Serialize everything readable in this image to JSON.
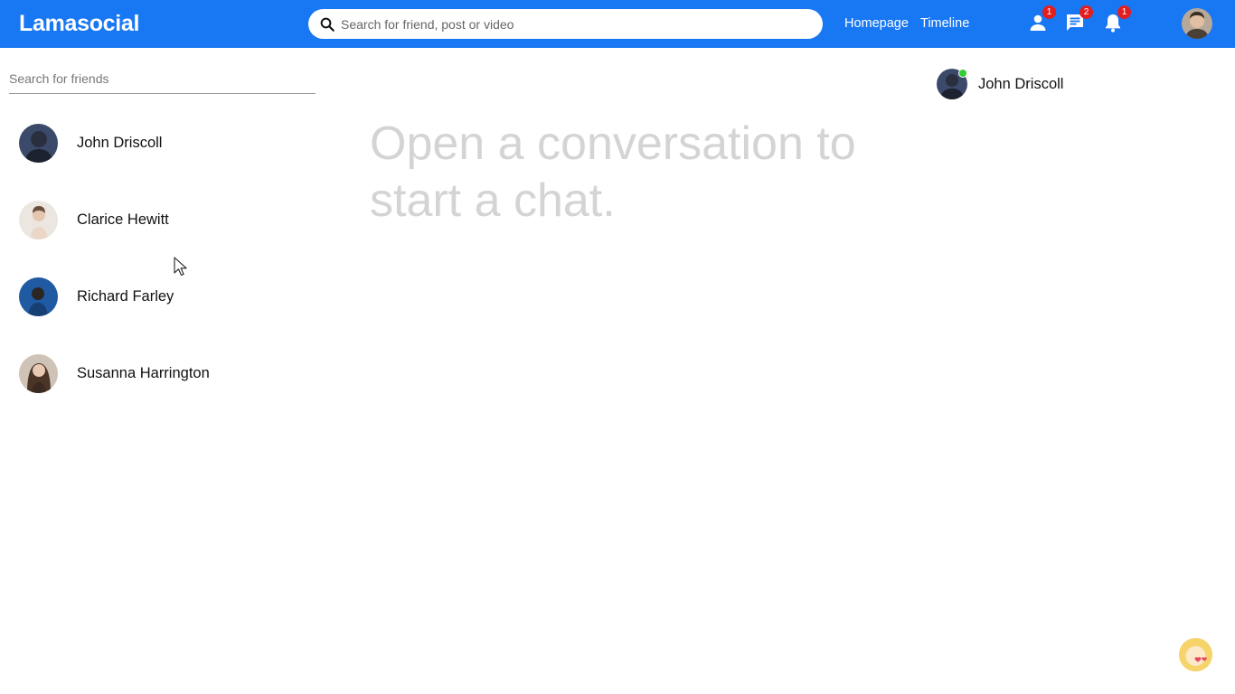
{
  "topbar": {
    "logo": "Lamasocial",
    "search_placeholder": "Search for friend, post or video",
    "links": [
      "Homepage",
      "Timeline"
    ],
    "badges": {
      "friends": "1",
      "messages": "2",
      "notifications": "1"
    }
  },
  "chatmenu": {
    "search_placeholder": "Search for friends",
    "conversations": [
      {
        "name": "John Driscoll"
      },
      {
        "name": "Clarice Hewitt"
      },
      {
        "name": "Richard Farley"
      },
      {
        "name": "Susanna Harrington"
      }
    ]
  },
  "chatbox": {
    "no_conversation_text": "Open a conversation to start a chat."
  },
  "chatonline": {
    "friends": [
      {
        "name": "John Driscoll"
      }
    ]
  }
}
